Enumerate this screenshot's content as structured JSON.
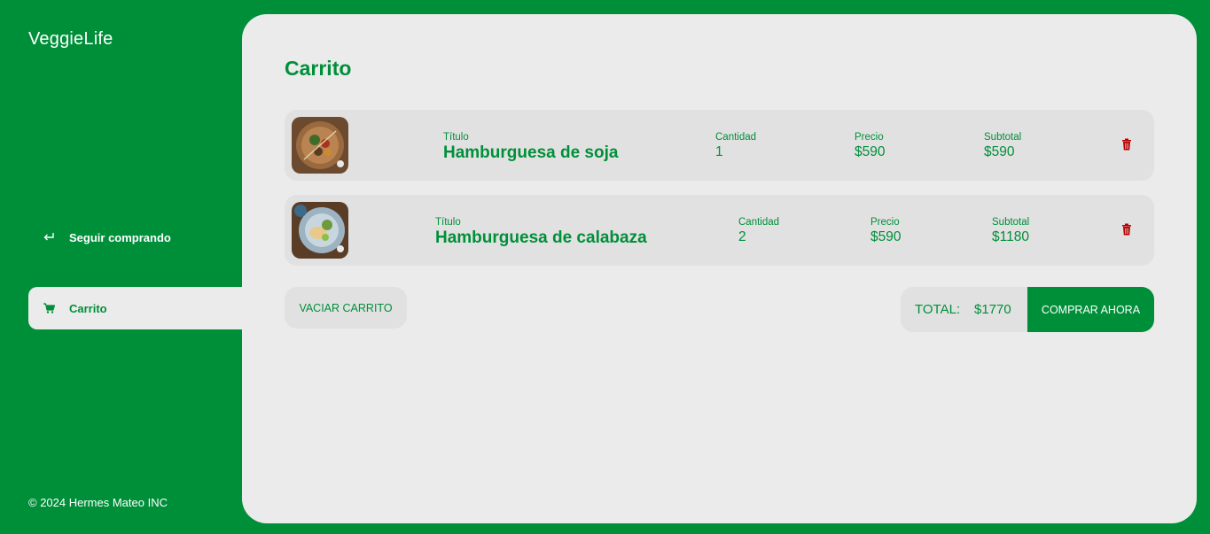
{
  "brand": {
    "name": "VeggieLife"
  },
  "nav": {
    "continue_label": "Seguir comprando",
    "cart_label": "Carrito"
  },
  "footer": {
    "text": "© 2024 Hermes Mateo INC"
  },
  "cart": {
    "title": "Carrito",
    "labels": {
      "title": "Título",
      "quantity": "Cantidad",
      "price": "Precio",
      "subtotal": "Subtotal"
    },
    "items": [
      {
        "title": "Hamburguesa de soja",
        "quantity": "1",
        "price": "$590",
        "subtotal": "$590"
      },
      {
        "title": "Hamburguesa de calabaza",
        "quantity": "2",
        "price": "$590",
        "subtotal": "$1180"
      }
    ],
    "empty_label": "VACIAR CARRITO",
    "total_label": "TOTAL:",
    "total_value": "$1770",
    "buy_label": "COMPRAR AHORA"
  },
  "colors": {
    "brand_green": "#008f39",
    "panel_bg": "#ebebeb",
    "card_bg": "#e1e1e1",
    "trash_red": "#b80000"
  }
}
